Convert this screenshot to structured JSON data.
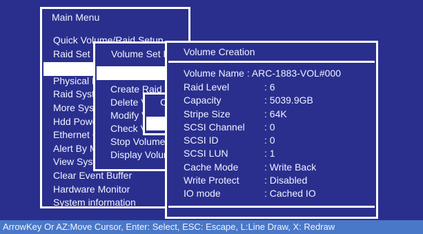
{
  "main_menu": {
    "title": "Main Menu",
    "items": [
      "Quick Volume/Raid Setup",
      "Raid Set Function",
      "",
      "Physical Drives",
      "Raid System Function",
      "More System Functions",
      "Hdd Power Management",
      "Ethernet Configuration",
      "Alert By Mail Config",
      "View System Events",
      "Clear Event Buffer",
      "Hardware Monitor",
      "System information"
    ]
  },
  "volume_set": {
    "title": "Volume Set Functions",
    "items": [
      "Create Raid Volume",
      "Delete Volume Set",
      "Modify Volume Set",
      "Check Volume Set",
      "Stop Volume Check",
      "Display Volume Info"
    ]
  },
  "small_popup": {
    "label": "C"
  },
  "volume_creation": {
    "title": "Volume Creation",
    "volume_name_label": "Volume Name : ",
    "volume_name_value": "ARC-1883-VOL#000",
    "fields": [
      {
        "label": "Raid Level",
        "value": ":  6"
      },
      {
        "label": "Capacity",
        "value": ":  5039.9GB"
      },
      {
        "label": "Stripe Size",
        "value": ":  64K"
      },
      {
        "label": "SCSI  Channel",
        "value": ":  0"
      },
      {
        "label": "SCSI  ID",
        "value": ":  0"
      },
      {
        "label": "SCSI  LUN",
        "value": ":  1"
      },
      {
        "label": "Cache Mode",
        "value": ":  Write Back"
      },
      {
        "label": "Write Protect",
        "value": ": Disabled"
      },
      {
        "label": "IO mode",
        "value": ": Cached IO"
      }
    ]
  },
  "status_bar": {
    "text": "ArrowKey Or AZ:Move Cursor, Enter: Select, ESC: Escape, L:Line Draw, X: Redraw"
  },
  "colors": {
    "background": "#2a2f8e",
    "border": "#ffffff",
    "status_bar": "#4a78c8"
  }
}
